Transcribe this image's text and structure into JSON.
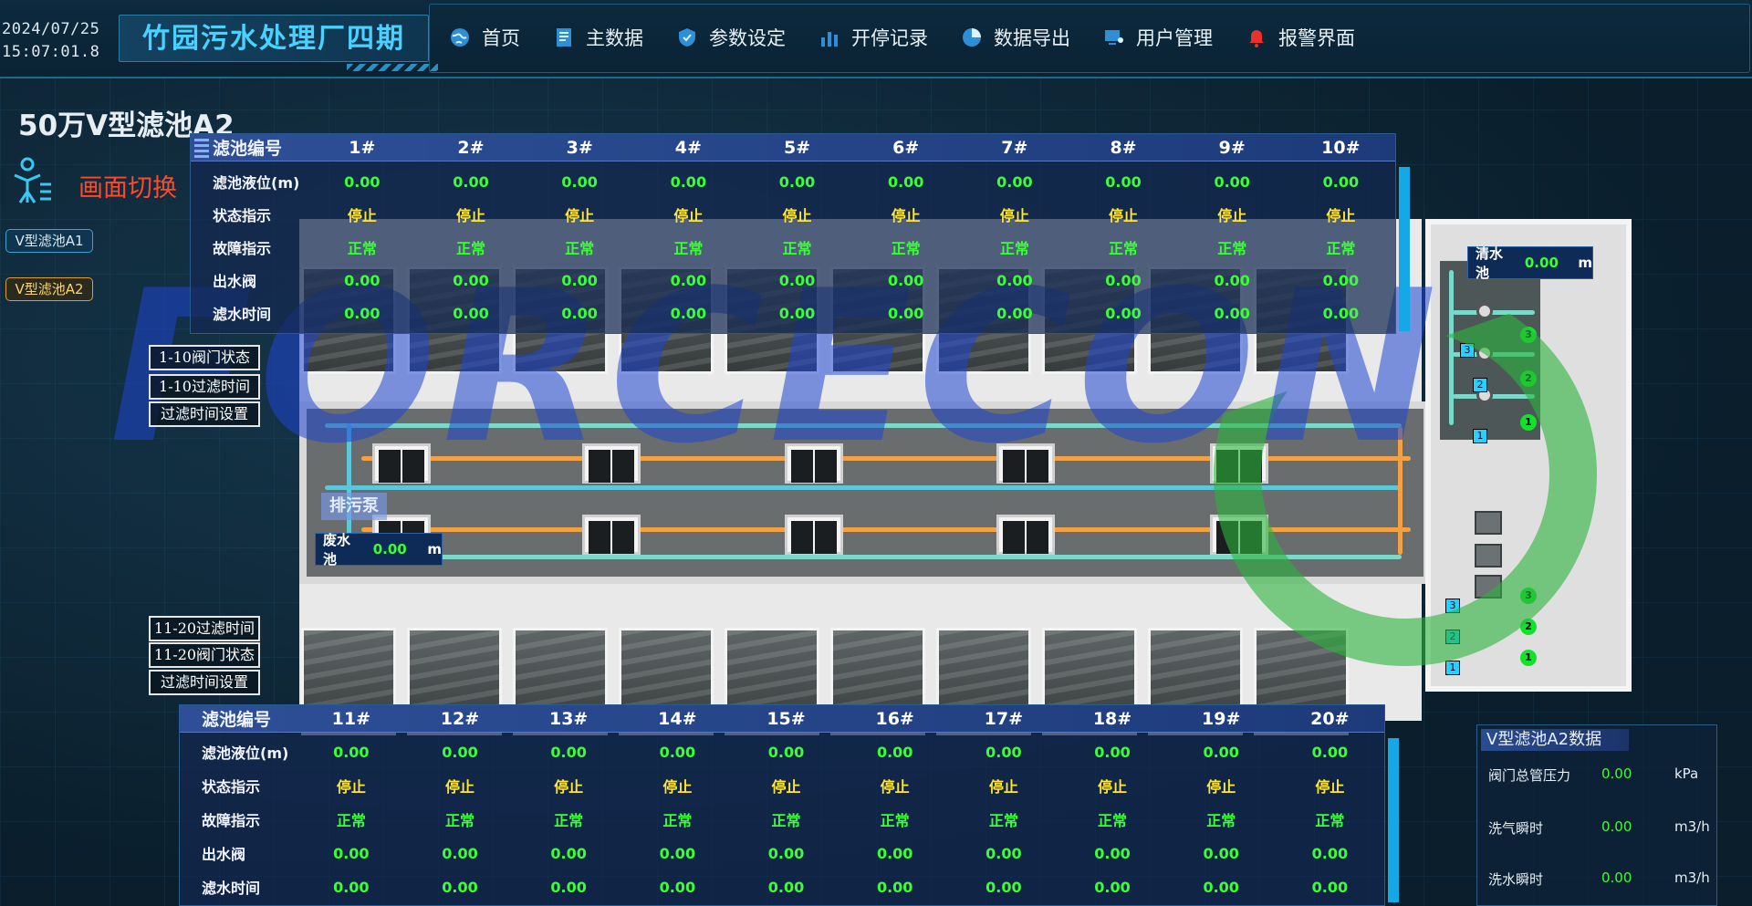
{
  "header": {
    "date": "2024/07/25",
    "time": "15:07:01.8",
    "plant_title": "竹园污水处理厂四期",
    "nav": [
      {
        "label": "首页",
        "icon": "globe-icon"
      },
      {
        "label": "主数据",
        "icon": "document-icon"
      },
      {
        "label": "参数设定",
        "icon": "shield-icon"
      },
      {
        "label": "开停记录",
        "icon": "bar-chart-icon"
      },
      {
        "label": "数据导出",
        "icon": "pie-chart-icon"
      },
      {
        "label": "用户管理",
        "icon": "user-monitor-icon"
      },
      {
        "label": "报警界面",
        "icon": "alarm-bell-icon"
      }
    ]
  },
  "page": {
    "title": "50万V型滤池A2",
    "switch_label": "画面切换",
    "tabs": [
      {
        "label": "V型滤池A1",
        "active": false
      },
      {
        "label": "V型滤池A2",
        "active": true
      }
    ],
    "side_buttons_top": [
      "1-10阀门状态",
      "1-10过滤时间",
      "过滤时间设置"
    ],
    "side_buttons_bottom": [
      "11-20过滤时间",
      "11-20阀门状态",
      "过滤时间设置"
    ]
  },
  "table_top": {
    "header_label": "滤池编号",
    "columns": [
      "1#",
      "2#",
      "3#",
      "4#",
      "5#",
      "6#",
      "7#",
      "8#",
      "9#",
      "10#"
    ],
    "rows": [
      {
        "label": "滤池液位(m)",
        "values": [
          "0.00",
          "0.00",
          "0.00",
          "0.00",
          "0.00",
          "0.00",
          "0.00",
          "0.00",
          "0.00",
          "0.00"
        ],
        "style": "green"
      },
      {
        "label": "状态指示",
        "values": [
          "停止",
          "停止",
          "停止",
          "停止",
          "停止",
          "停止",
          "停止",
          "停止",
          "停止",
          "停止"
        ],
        "style": "stop"
      },
      {
        "label": "故障指示",
        "values": [
          "正常",
          "正常",
          "正常",
          "正常",
          "正常",
          "正常",
          "正常",
          "正常",
          "正常",
          "正常"
        ],
        "style": "green"
      },
      {
        "label": "出水阀",
        "values": [
          "0.00",
          "0.00",
          "0.00",
          "0.00",
          "0.00",
          "0.00",
          "0.00",
          "0.00",
          "0.00",
          "0.00"
        ],
        "style": "green"
      },
      {
        "label": "滤水时间",
        "values": [
          "0.00",
          "0.00",
          "0.00",
          "0.00",
          "0.00",
          "0.00",
          "0.00",
          "0.00",
          "0.00",
          "0.00"
        ],
        "style": "green"
      }
    ]
  },
  "table_bottom": {
    "header_label": "滤池编号",
    "columns": [
      "11#",
      "12#",
      "13#",
      "14#",
      "15#",
      "16#",
      "17#",
      "18#",
      "19#",
      "20#"
    ],
    "rows": [
      {
        "label": "滤池液位(m)",
        "values": [
          "0.00",
          "0.00",
          "0.00",
          "0.00",
          "0.00",
          "0.00",
          "0.00",
          "0.00",
          "0.00",
          "0.00"
        ],
        "style": "green"
      },
      {
        "label": "状态指示",
        "values": [
          "停止",
          "停止",
          "停止",
          "停止",
          "停止",
          "停止",
          "停止",
          "停止",
          "停止",
          "停止"
        ],
        "style": "stop"
      },
      {
        "label": "故障指示",
        "values": [
          "正常",
          "正常",
          "正常",
          "正常",
          "正常",
          "正常",
          "正常",
          "正常",
          "正常",
          "正常"
        ],
        "style": "green"
      },
      {
        "label": "出水阀",
        "values": [
          "0.00",
          "0.00",
          "0.00",
          "0.00",
          "0.00",
          "0.00",
          "0.00",
          "0.00",
          "0.00",
          "0.00"
        ],
        "style": "green"
      },
      {
        "label": "滤水时间",
        "values": [
          "0.00",
          "0.00",
          "0.00",
          "0.00",
          "0.00",
          "0.00",
          "0.00",
          "0.00",
          "0.00",
          "0.00"
        ],
        "style": "green"
      }
    ]
  },
  "readouts": {
    "clear_water": {
      "label": "清水池",
      "value": "0.00",
      "unit": "m"
    },
    "waste_water": {
      "label": "废水池",
      "value": "0.00",
      "unit": "m"
    },
    "pump_label": "排污泵"
  },
  "equipment_tags": {
    "upper_numbers": [
      "3",
      "2",
      "1"
    ],
    "lower_numbers": [
      "3",
      "2",
      "1"
    ]
  },
  "side_data": {
    "title": "V型滤池A2数据",
    "rows": [
      {
        "label": "阀门总管压力",
        "value": "0.00",
        "unit": "kPa"
      },
      {
        "label": "洗气瞬时",
        "value": "0.00",
        "unit": "m3/h"
      },
      {
        "label": "洗水瞬时",
        "value": "0.00",
        "unit": "m3/h"
      }
    ]
  },
  "colors": {
    "accent": "#49d2ff",
    "ok_green": "#3bff34",
    "stop_yellow": "#ffe63a",
    "switch_red": "#ff4a2a"
  }
}
